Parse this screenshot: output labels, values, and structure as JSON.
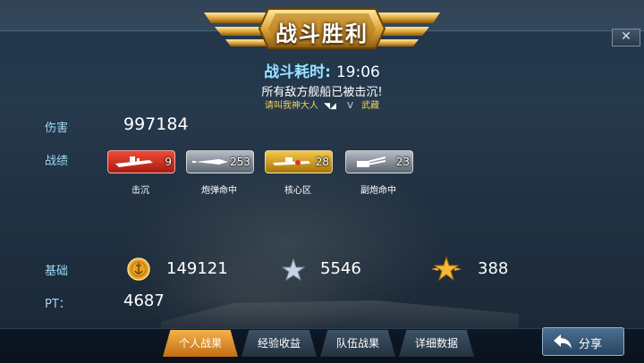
{
  "header": {
    "title": "战斗胜利",
    "close_symbol": "✕"
  },
  "battle": {
    "duration_label": "战斗耗时:",
    "duration_value": "19:06",
    "result_message": "所有敌方舰船已被击沉!",
    "player_name": "请叫我神大人",
    "vs": "V",
    "enemy_name": "武藏"
  },
  "stats": {
    "damage_label": "伤害",
    "damage_value": "997184",
    "record_label": "战绩",
    "medals": [
      {
        "icon": "warship-sinking-icon",
        "count": "9",
        "label": "击沉",
        "color": "#d9301f"
      },
      {
        "icon": "shell-hit-icon",
        "count": "253",
        "label": "炮弹命中",
        "color": "#8a949e"
      },
      {
        "icon": "citadel-hit-icon",
        "count": "28",
        "label": "核心区",
        "color": "#d39a18"
      },
      {
        "icon": "secondary-gun-icon",
        "count": "23",
        "label": "副炮命中",
        "color": "#8a949e"
      }
    ]
  },
  "rewards": {
    "base_label": "基础",
    "gold": "149121",
    "silver_xp": "5546",
    "gold_xp": "388",
    "pt_label": "PT：",
    "pt_value": "4687"
  },
  "tabs": [
    {
      "label": "个人战果",
      "active": true
    },
    {
      "label": "经验收益",
      "active": false
    },
    {
      "label": "队伍战果",
      "active": false
    },
    {
      "label": "详细数据",
      "active": false
    }
  ],
  "share": {
    "label": "分享"
  }
}
